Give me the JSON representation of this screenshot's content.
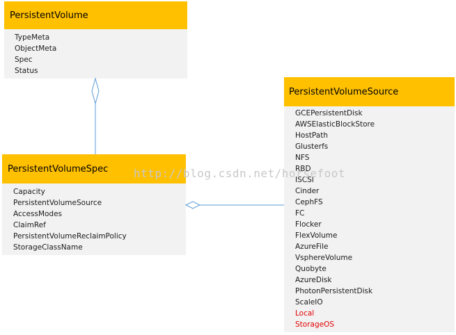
{
  "classes": {
    "persistent_volume": {
      "title": "PersistentVolume",
      "attributes": [
        "TypeMeta",
        "ObjectMeta",
        "Spec",
        "Status"
      ]
    },
    "persistent_volume_spec": {
      "title": "PersistentVolumeSpec",
      "attributes": [
        "Capacity",
        "PersistentVolumeSource",
        "AccessModes",
        "ClaimRef",
        "PersistentVolumeReclaimPolicy",
        "StorageClassName"
      ]
    },
    "persistent_volume_source": {
      "title": "PersistentVolumeSource",
      "attributes": [
        "GCEPersistentDisk",
        "AWSElasticBlockStore",
        "HostPath",
        "Glusterfs",
        "NFS",
        "RBD",
        "ISCSI",
        "Cinder",
        "CephFS",
        "FC",
        "Flocker",
        "FlexVolume",
        "AzureFile",
        "VsphereVolume",
        "Quobyte",
        "AzureDisk",
        "PhotonPersistentDisk",
        "ScaleIO",
        "Local",
        "StorageOS"
      ]
    }
  },
  "watermark": "http://blog.csdn.net/horsefoot",
  "colors": {
    "header": "#ffc000",
    "body": "#f2f2f2",
    "connector": "#5b9bd5",
    "highlight": "#e00000"
  }
}
